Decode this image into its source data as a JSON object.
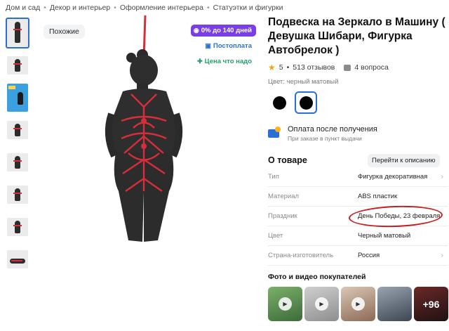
{
  "breadcrumb": [
    "Дом и сад",
    "Декор и интерьер",
    "Оформление интерьера",
    "Статуэтки и фигурки"
  ],
  "gallery": {
    "similar_label": "Похожие",
    "badges": [
      {
        "icon": "percent-icon",
        "text": "0% до 140 дней",
        "color": "#7a3ee6"
      },
      {
        "icon": "postpay-icon",
        "text": "Постоплата",
        "color": "#2a6fd6"
      },
      {
        "icon": "good-price-icon",
        "text": "Цена что надо",
        "color": "#23a06b"
      }
    ]
  },
  "product": {
    "title": "Подвеска на Зеркало в Машину ( Девушка Шибари, Фигурка Автобрелок )",
    "rating": "5",
    "reviews": "513 отзывов",
    "questions": "4 вопроса",
    "color_label": "Цвет: черный матовый",
    "payment_title": "Оплата после получения",
    "payment_sub": "При заказе в пункт выдачи"
  },
  "about": {
    "heading": "О товаре",
    "description_button": "Перейти к описанию",
    "specs": [
      {
        "key": "Тип",
        "value": "Фигурка декоративная"
      },
      {
        "key": "Материал",
        "value": "ABS пластик"
      },
      {
        "key": "Праздник",
        "value": "День Победы, 23 февраля"
      },
      {
        "key": "Цвет",
        "value": "Черный матовый"
      },
      {
        "key": "Страна-изготовитель",
        "value": "Россия"
      }
    ]
  },
  "photos": {
    "heading": "Фото и видео покупателей",
    "more": "+96"
  },
  "colors": {
    "accent": "#2a6fd6",
    "star": "#f3a20d",
    "rope": "#d62e3a",
    "annotation": "#c81e1e"
  }
}
